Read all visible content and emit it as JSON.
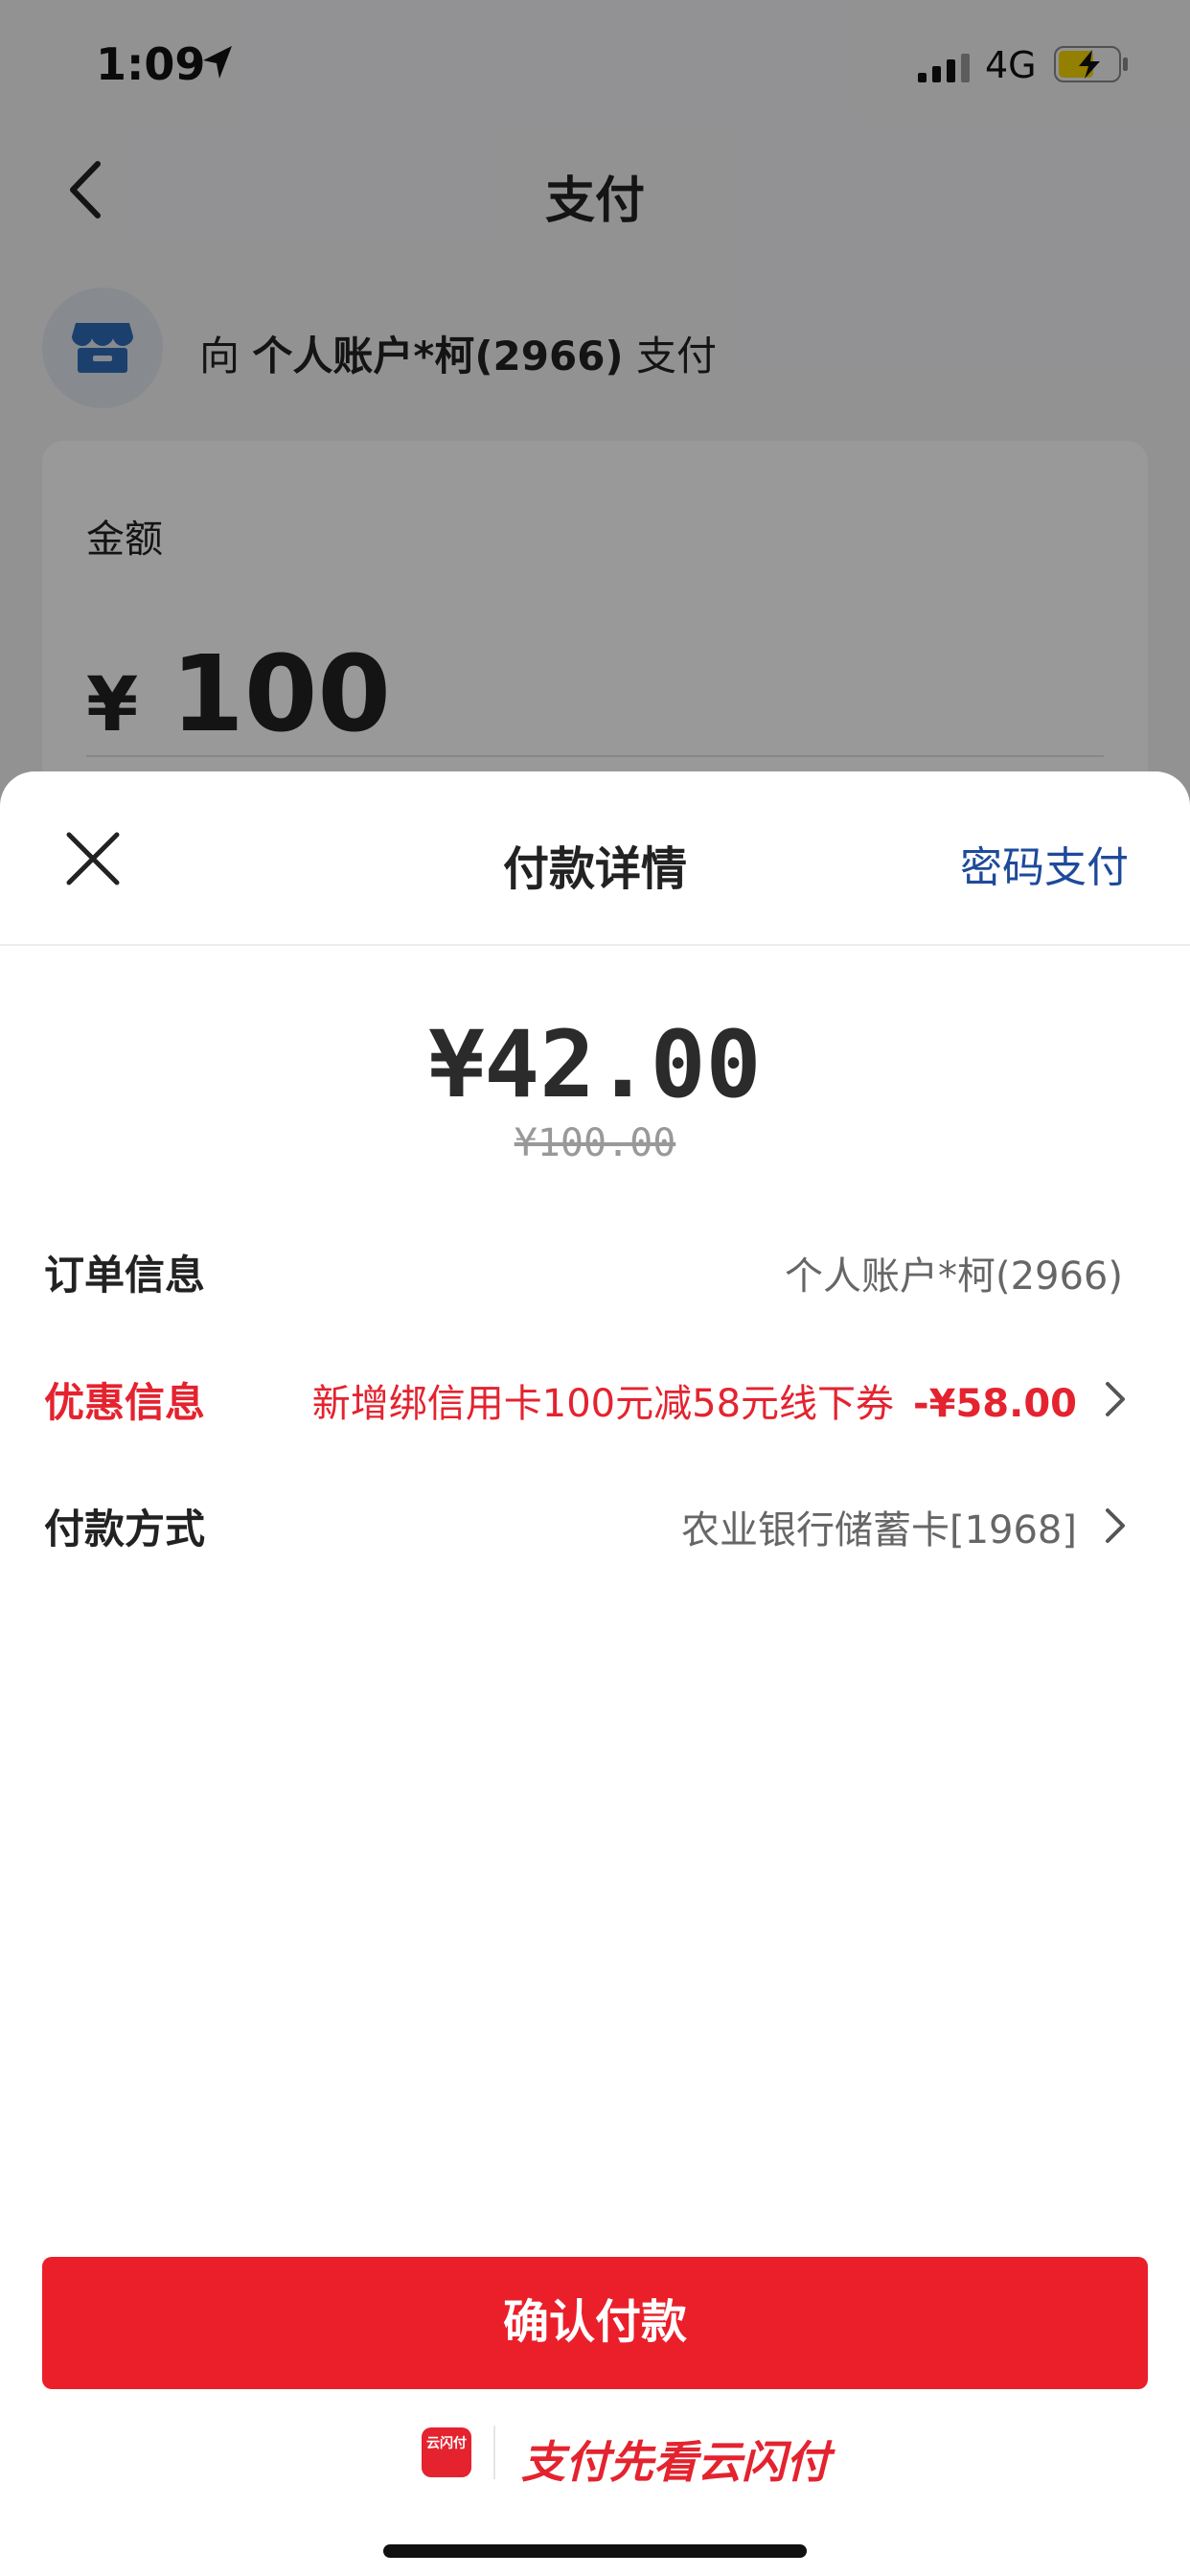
{
  "status_bar": {
    "time": "1:09",
    "network": "4G",
    "battery_color": "#f5d400"
  },
  "nav": {
    "title": "支付"
  },
  "payee": {
    "prefix": "向 ",
    "name": "个人账户*柯(2966)",
    "suffix": " 支付",
    "icon": "store-icon"
  },
  "amount_card": {
    "label": "金额",
    "currency": "¥",
    "value": "100"
  },
  "sheet": {
    "title": "付款详情",
    "password_pay": "密码支付",
    "price": "¥42.00",
    "original_price": "¥100.00",
    "rows": [
      {
        "label": "订单信息",
        "value": "个人账户*柯(2966)"
      },
      {
        "label": "优惠信息",
        "value": "新增绑信用卡100元减58元线下券",
        "amount": "-¥58.00"
      },
      {
        "label": "付款方式",
        "value": "农业银行储蓄卡[1968]"
      }
    ],
    "confirm_label": "确认付款"
  },
  "footer": {
    "logo_text": "云闪付",
    "slogan": "支付先看云闪付"
  },
  "colors": {
    "accent_red": "#ea1f2a",
    "link_blue": "#1e4a9a"
  }
}
